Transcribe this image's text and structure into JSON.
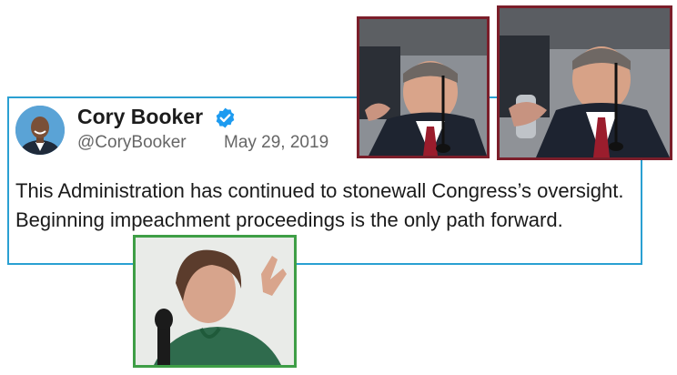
{
  "tweet": {
    "author_name": "Cory Booker",
    "handle": "@CoryBooker",
    "date": "May 29, 2019",
    "text": "This Administration has continued to stonewall Congress’s oversight. Beginning impeachment proceedings is the only path forward.",
    "verified_icon": "verified-badge-icon",
    "accent_color": "#2aa0d2"
  },
  "photos": {
    "top_border_color": "#7b1e2a",
    "bottom_border_color": "#3e9e46"
  }
}
